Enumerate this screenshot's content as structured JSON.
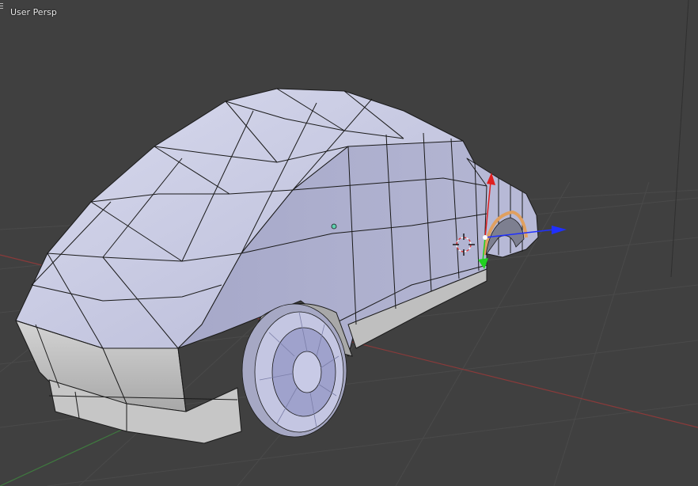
{
  "viewport": {
    "label": "User Persp",
    "mode": "perspective",
    "background_color": "#404040"
  },
  "scene": {
    "object": "car-body-mesh",
    "grid_color": "#4a4a4a",
    "x_axis_color": "#8a3a3a",
    "y_axis_color": "#3f7a3f"
  },
  "gizmo": {
    "x_color": "#e02020",
    "y_color": "#20d020",
    "z_color": "#2030ff"
  },
  "icons": {
    "corner": "view-menu-icon",
    "cursor": "3d-cursor-icon",
    "origin": "object-origin-icon"
  }
}
